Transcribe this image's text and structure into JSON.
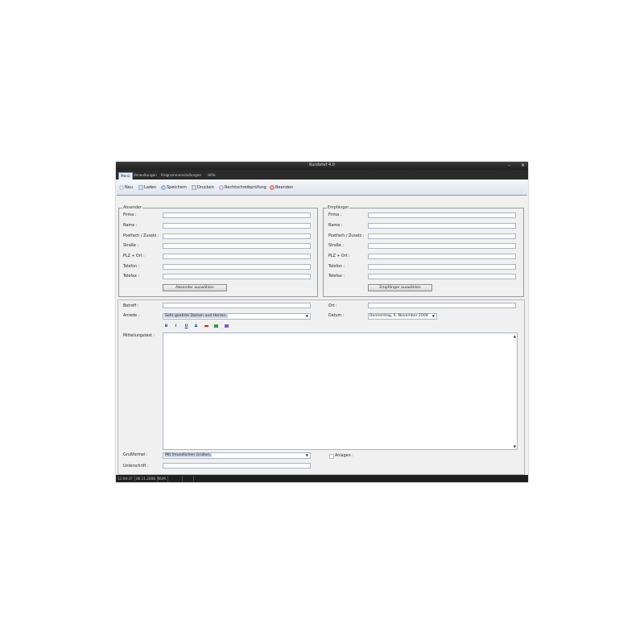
{
  "window": {
    "title": "Kurzbrief 4.0",
    "minimize": "–",
    "close": "✕"
  },
  "menu": {
    "tabs": [
      "Menü",
      "Verwaltungen",
      "Programmeinstellungen",
      "Hilfe"
    ]
  },
  "ribbon": {
    "neu": "Neu",
    "laden": "Laden",
    "speichern": "Speichern",
    "drucken": "Drucken",
    "rechtschreib": "Rechtschreibprüfung",
    "beenden": "Beenden"
  },
  "absender": {
    "title": "Absender",
    "labels": [
      "Firma :",
      "Name :",
      "Postfach / Zusatz :",
      "Straße :",
      "PLZ + Ort :",
      "Telefon :",
      "Telefax :"
    ],
    "button": "Absender auswählen"
  },
  "empfaenger": {
    "title": "Empfänger",
    "labels": [
      "Firma :",
      "Name :",
      "Postfach / Zusatz :",
      "Straße :",
      "PLZ + Ort :",
      "Telefon :",
      "Telefax :"
    ],
    "button": "Empfänger auswählen"
  },
  "message": {
    "betreff_label": "Betreff :",
    "anrede_label": "Anrede :",
    "anrede_value": "Sehr geehrte Damen und Herren,",
    "ort_label": "Ort :",
    "datum_label": "Datum :",
    "datum_value": "Donnerstag,  6. November  2008",
    "text_label": "Mitteilungstext :",
    "gruss_label": "Grußformel :",
    "gruss_value": "Mit freundlichen Grüßen,",
    "unterschrift_label": "Unterschrift :",
    "anlagen_label": "Anlagen :"
  },
  "format": {
    "bold": "B",
    "italic": "I",
    "underline": "U",
    "strike": "S"
  },
  "status": {
    "time": "11:04:37",
    "date": "06.11.2008",
    "num": "NUM"
  },
  "colors": {
    "titlebar": "#2a2a2a",
    "ribbon": "#e3e8ef",
    "status": "#1e1e1e"
  }
}
